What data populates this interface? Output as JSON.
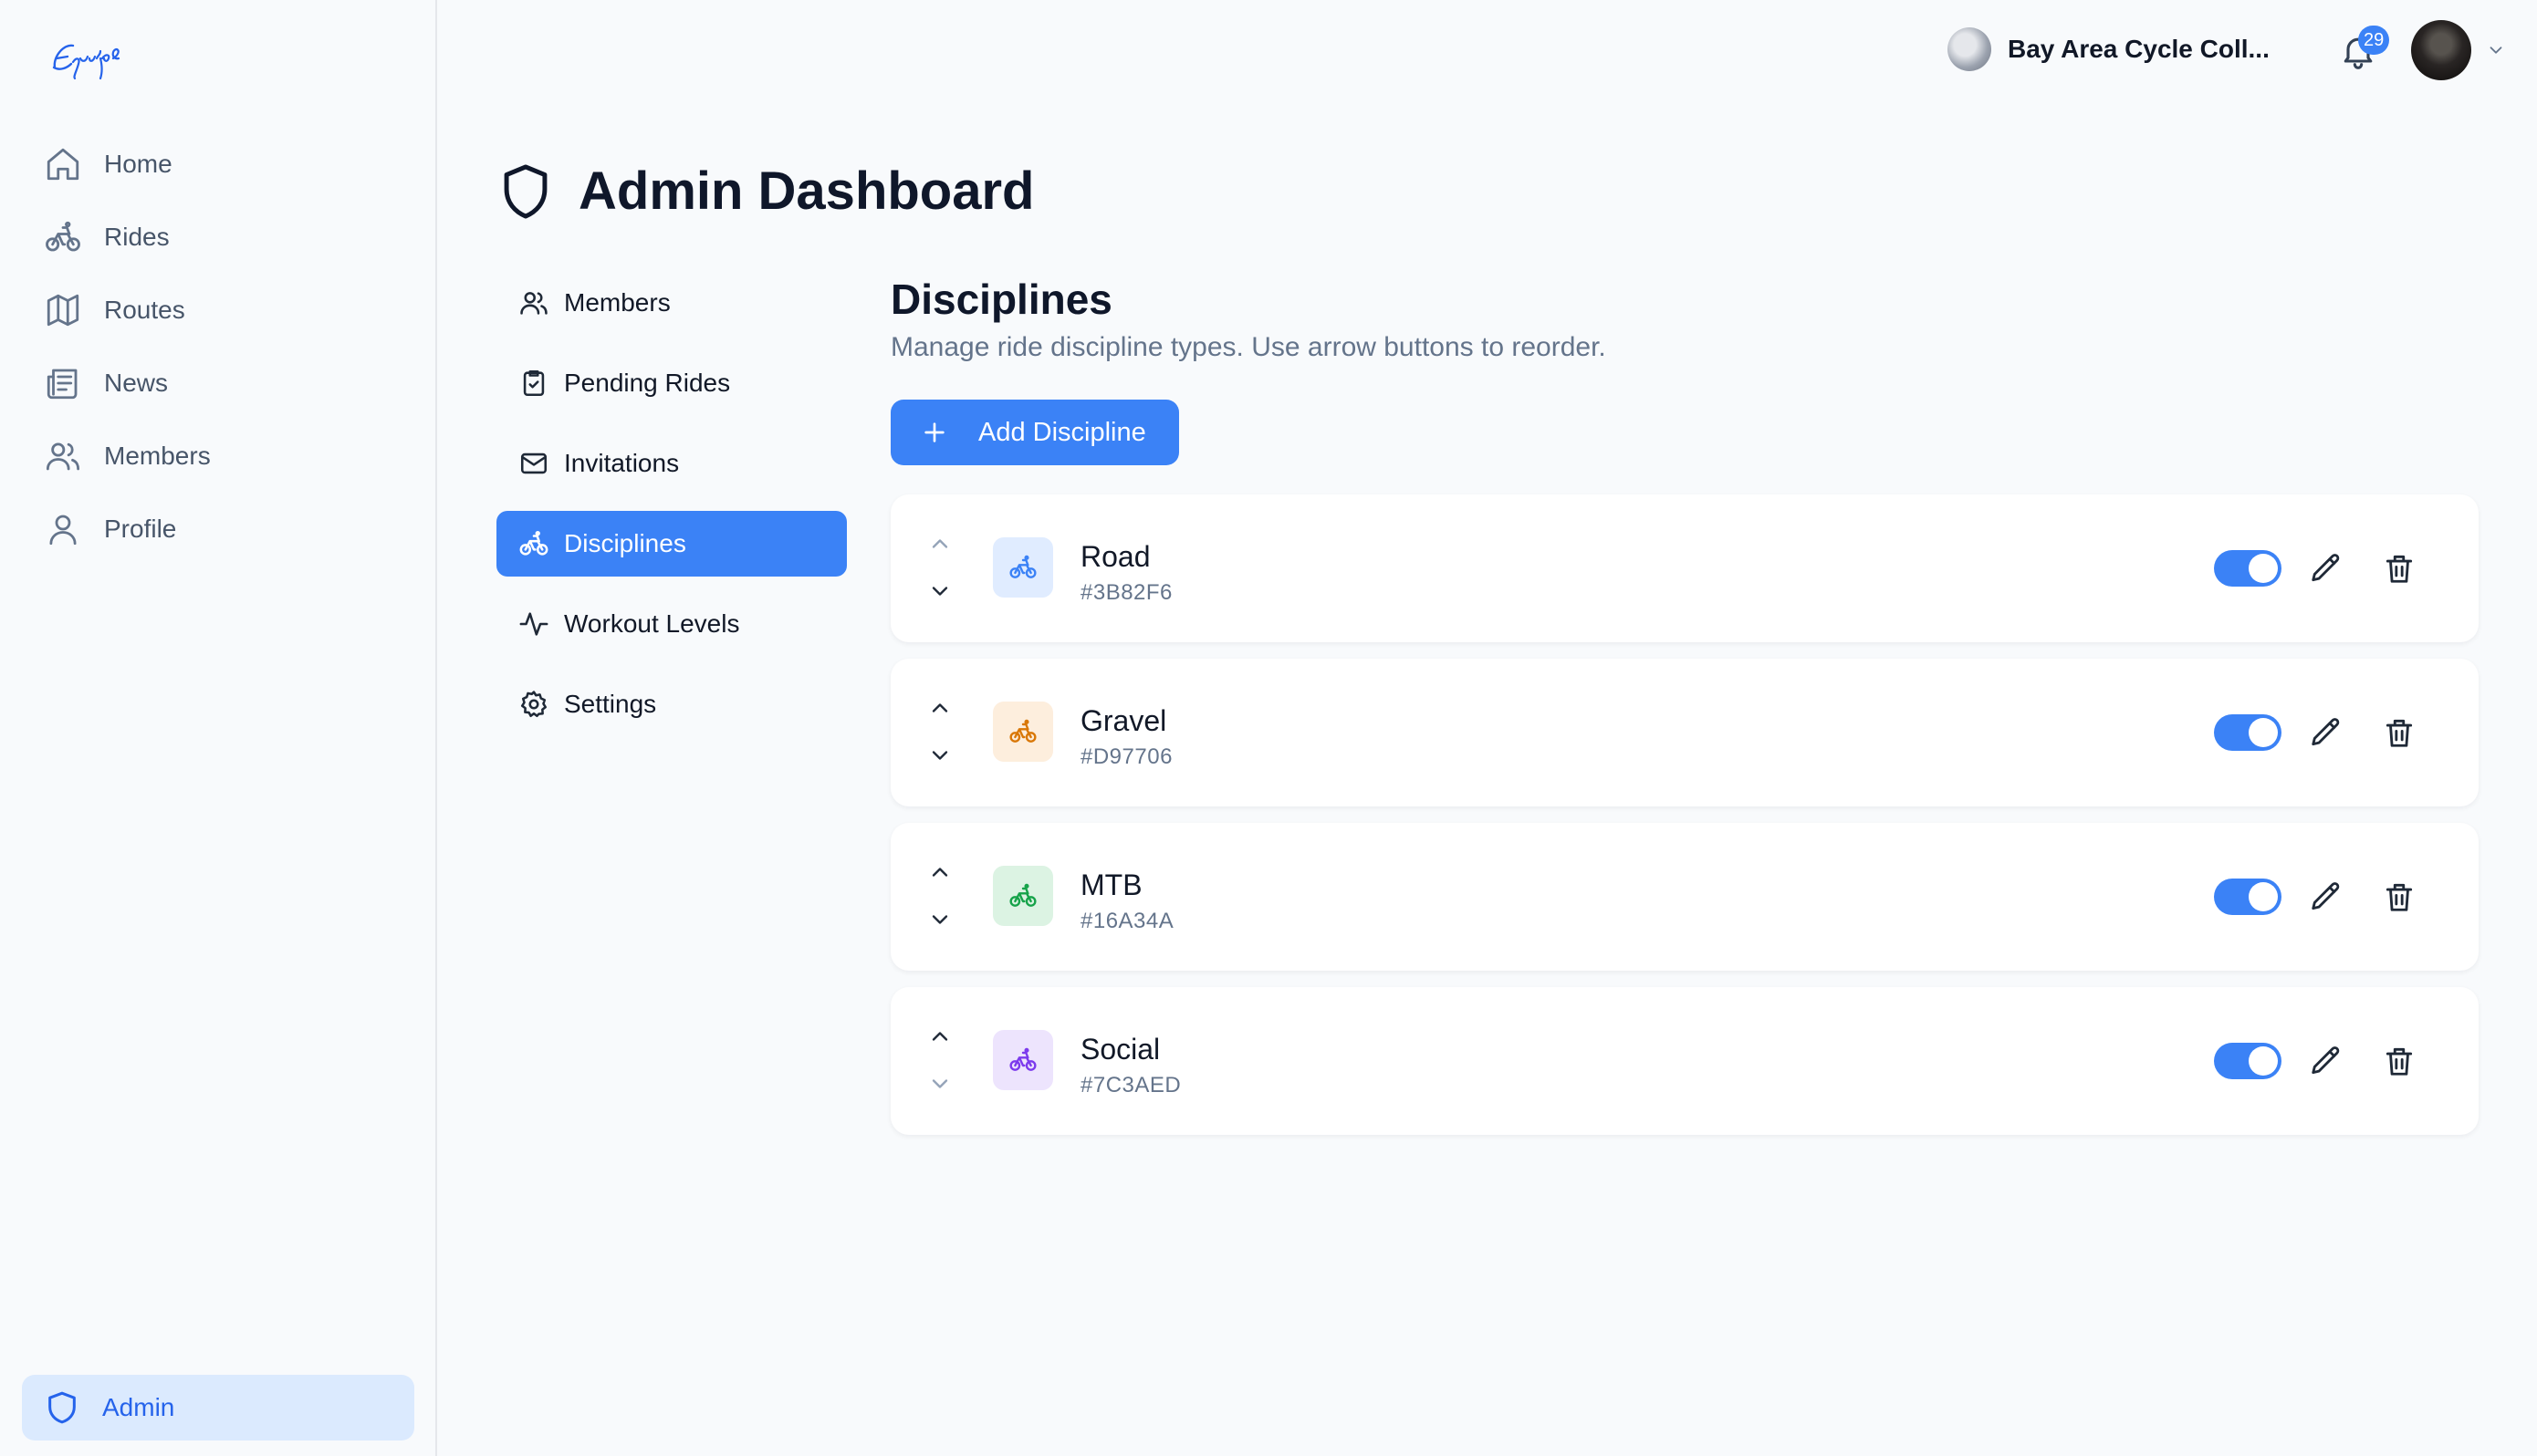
{
  "app": {
    "logo_text": "Equipe"
  },
  "sidebar": {
    "items": [
      {
        "label": "Home",
        "icon": "home-icon"
      },
      {
        "label": "Rides",
        "icon": "bike-icon"
      },
      {
        "label": "Routes",
        "icon": "map-icon"
      },
      {
        "label": "News",
        "icon": "newspaper-icon"
      },
      {
        "label": "Members",
        "icon": "users-icon"
      },
      {
        "label": "Profile",
        "icon": "user-icon"
      }
    ],
    "admin": {
      "label": "Admin",
      "icon": "shield-icon"
    }
  },
  "header": {
    "org_name": "Bay Area Cycle Coll...",
    "notification_count": "29"
  },
  "page": {
    "title": "Admin Dashboard"
  },
  "subnav": {
    "items": [
      {
        "label": "Members",
        "icon": "users-icon",
        "active": false
      },
      {
        "label": "Pending Rides",
        "icon": "clipboard-check-icon",
        "active": false
      },
      {
        "label": "Invitations",
        "icon": "mail-icon",
        "active": false
      },
      {
        "label": "Disciplines",
        "icon": "bike-icon",
        "active": true
      },
      {
        "label": "Workout Levels",
        "icon": "activity-icon",
        "active": false
      },
      {
        "label": "Settings",
        "icon": "gear-icon",
        "active": false
      }
    ]
  },
  "main": {
    "title": "Disciplines",
    "subtitle": "Manage ride discipline types. Use arrow buttons to reorder.",
    "add_button_label": "Add Discipline",
    "disciplines": [
      {
        "name": "Road",
        "hex": "#3B82F6",
        "color": "#3B82F6",
        "tint": "#e0ecff",
        "enabled": true
      },
      {
        "name": "Gravel",
        "hex": "#D97706",
        "color": "#D97706",
        "tint": "#fdeedd",
        "enabled": true
      },
      {
        "name": "MTB",
        "hex": "#16A34A",
        "color": "#16A34A",
        "tint": "#dcf3e3",
        "enabled": true
      },
      {
        "name": "Social",
        "hex": "#7C3AED",
        "color": "#7C3AED",
        "tint": "#ede4fd",
        "enabled": true
      }
    ]
  }
}
